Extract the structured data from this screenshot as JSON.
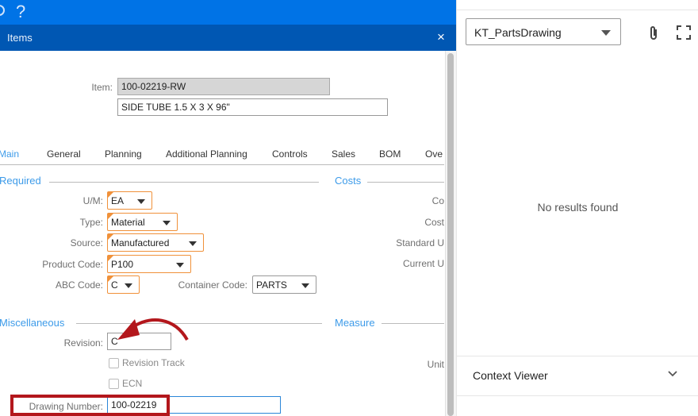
{
  "topbar": {
    "help_icon": "?"
  },
  "window": {
    "title": "Items",
    "close_icon": "×"
  },
  "item": {
    "label": "Item:",
    "code": "100-02219-RW",
    "description": "SIDE TUBE 1.5 X 3 X 96\""
  },
  "tabs": [
    {
      "label": "Main",
      "active": true
    },
    {
      "label": "General"
    },
    {
      "label": "Planning"
    },
    {
      "label": "Additional Planning"
    },
    {
      "label": "Controls"
    },
    {
      "label": "Sales"
    },
    {
      "label": "BOM"
    },
    {
      "label": "Ove"
    }
  ],
  "required": {
    "title": "Required",
    "um": {
      "label": "U/M:",
      "value": "EA"
    },
    "type": {
      "label": "Type:",
      "value": "Material"
    },
    "source": {
      "label": "Source:",
      "value": "Manufactured"
    },
    "product_code": {
      "label": "Product Code:",
      "value": "P100"
    },
    "abc_code": {
      "label": "ABC Code:",
      "value": "C"
    },
    "container_code": {
      "label": "Container Code:",
      "value": "PARTS"
    }
  },
  "costs": {
    "title": "Costs",
    "labels": [
      "Co",
      "Cost",
      "Standard U",
      "Current U"
    ]
  },
  "misc": {
    "title": "Miscellaneous",
    "revision": {
      "label": "Revision:",
      "value": "C"
    },
    "revision_track": {
      "label": "Revision Track",
      "checked": false
    },
    "ecn": {
      "label": "ECN",
      "checked": false
    },
    "drawing_number": {
      "label": "Drawing Number:",
      "value": "100-02219"
    }
  },
  "measure": {
    "title": "Measure",
    "unit_label": "Unit"
  },
  "right_panel": {
    "dropdown_value": "KT_PartsDrawing",
    "no_results": "No results found",
    "context_viewer": "Context Viewer"
  },
  "annotation_colors": {
    "highlight": "#b3171c",
    "accent": "#3d9be9",
    "required": "#f0913a"
  }
}
